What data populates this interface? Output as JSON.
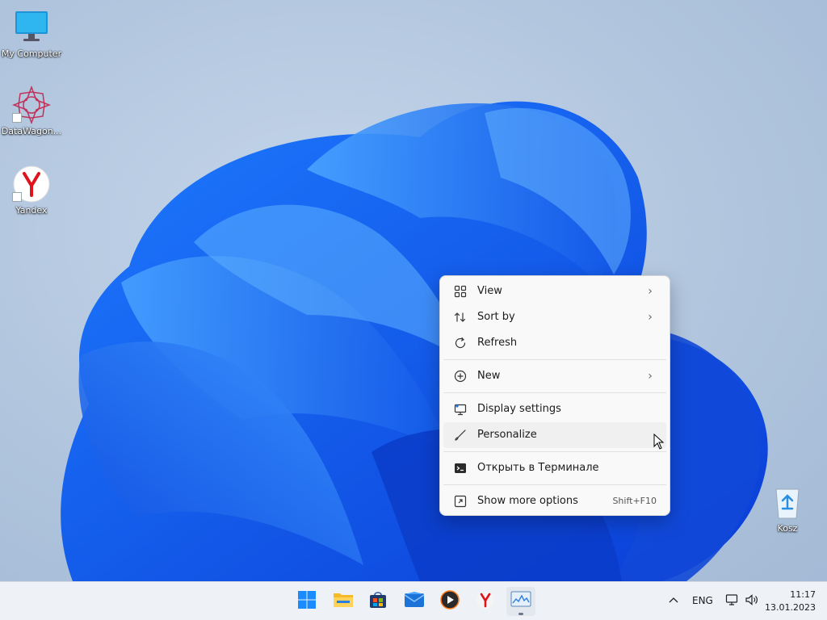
{
  "desktop": {
    "icons": [
      {
        "label": "My Computer",
        "icon": "monitor-icon"
      },
      {
        "label": "DataWagon...",
        "icon": "datawagon-icon"
      },
      {
        "label": "Yandex",
        "icon": "yandex-icon"
      },
      {
        "label": "Kosz",
        "icon": "recycle-bin-icon"
      }
    ]
  },
  "context_menu": {
    "items": [
      {
        "label": "View",
        "icon": "grid-icon",
        "submenu": true
      },
      {
        "label": "Sort by",
        "icon": "sort-icon",
        "submenu": true
      },
      {
        "label": "Refresh",
        "icon": "refresh-icon",
        "submenu": false
      },
      {
        "label": "New",
        "icon": "plus-circle-icon",
        "submenu": true
      },
      {
        "label": "Display settings",
        "icon": "display-icon",
        "submenu": false
      },
      {
        "label": "Personalize",
        "icon": "brush-icon",
        "submenu": false
      },
      {
        "label": "Открыть в Терминале",
        "icon": "terminal-icon",
        "submenu": false
      },
      {
        "label": "Show more options",
        "icon": "more-options-icon",
        "shortcut": "Shift+F10"
      }
    ],
    "hovered": "Personalize"
  },
  "taskbar": {
    "apps": [
      {
        "name": "Start",
        "icon": "windows-start-icon"
      },
      {
        "name": "File Explorer",
        "icon": "folder-icon"
      },
      {
        "name": "Microsoft Store",
        "icon": "store-icon"
      },
      {
        "name": "Mail",
        "icon": "mail-icon"
      },
      {
        "name": "Media Player",
        "icon": "media-player-icon"
      },
      {
        "name": "Yandex",
        "icon": "yandex-icon"
      },
      {
        "name": "Task Manager",
        "icon": "task-manager-icon",
        "active": true
      }
    ],
    "tray": {
      "language": "ENG",
      "time": "11:17",
      "date": "13.01.2023"
    }
  },
  "colors": {
    "accent": "#1a73e8",
    "menu_bg": "#f9f9f9",
    "taskbar_bg": "#eef1f6"
  }
}
